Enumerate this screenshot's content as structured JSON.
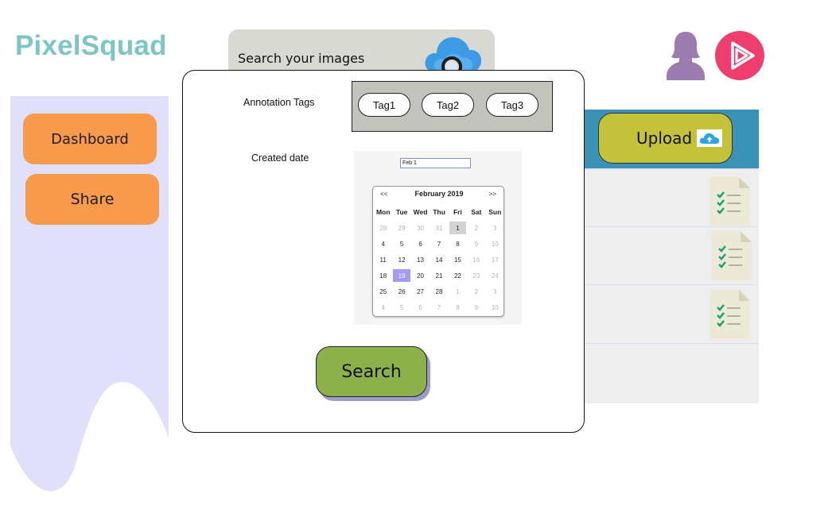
{
  "app": {
    "logo": "PixelSquad"
  },
  "search": {
    "placeholder": "Search your images"
  },
  "sidebar": {
    "items": [
      {
        "label": "Dashboard"
      },
      {
        "label": "Share"
      }
    ]
  },
  "panel": {
    "upload_label": "Upload",
    "rows": [
      {
        "icon": "checklist-document-icon"
      },
      {
        "icon": "checklist-document-icon"
      },
      {
        "icon": "checklist-document-icon"
      }
    ]
  },
  "modal": {
    "tags_label": "Annotation Tags",
    "tags": [
      "Tag1",
      "Tag2",
      "Tag3"
    ],
    "date_label": "Created date",
    "date_value": "Feb 1",
    "calendar": {
      "prev": "<<",
      "next": ">>",
      "month": "February 2019",
      "weekdays": [
        "Mon",
        "Tue",
        "Wed",
        "Thu",
        "Fri",
        "Sat",
        "Sun"
      ],
      "weeks": [
        [
          "28",
          "29",
          "30",
          "31",
          "1",
          "2",
          "3"
        ],
        [
          "4",
          "5",
          "6",
          "7",
          "8",
          "9",
          "10"
        ],
        [
          "11",
          "12",
          "13",
          "14",
          "15",
          "16",
          "17"
        ],
        [
          "18",
          "19",
          "20",
          "21",
          "22",
          "23",
          "24"
        ],
        [
          "25",
          "26",
          "27",
          "28",
          "1",
          "2",
          "3"
        ],
        [
          "4",
          "5",
          "6",
          "7",
          "8",
          "9",
          "10"
        ]
      ],
      "selected_day": "1",
      "highlighted_day": "19"
    },
    "search_button": "Search"
  },
  "colors": {
    "logo": "#7cc6c4",
    "sidebar": "#e0e0fb",
    "orange_button": "#f79a4b",
    "panel_header": "#3a93b6",
    "upload_button": "#c3c23a",
    "search_button": "#8cb04a",
    "user_icon": "#9b7bb0",
    "ps_icon": "#ef3e6e",
    "calendar_highlight": "#a49bf6"
  }
}
